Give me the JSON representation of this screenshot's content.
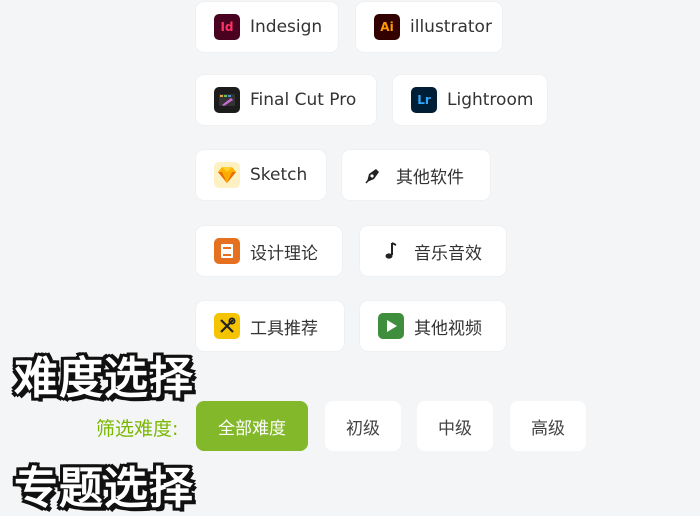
{
  "software": {
    "indesign": {
      "label": "Indesign",
      "icon_text": "Id"
    },
    "illustrator": {
      "label": "illustrator",
      "icon_text": "Ai"
    },
    "finalcut": {
      "label": "Final Cut Pro"
    },
    "lightroom": {
      "label": "Lightroom",
      "icon_text": "Lr"
    },
    "sketch": {
      "label": "Sketch"
    },
    "other_software": {
      "label": "其他软件"
    },
    "design_theory": {
      "label": "设计理论"
    },
    "music_sfx": {
      "label": "音乐音效"
    },
    "tools": {
      "label": "工具推荐"
    },
    "other_video": {
      "label": "其他视频"
    }
  },
  "headers": {
    "difficulty": "难度选择",
    "next": "专题选择"
  },
  "filter": {
    "label": "筛选难度:",
    "options": [
      {
        "label": "全部难度",
        "active": true
      },
      {
        "label": "初级",
        "active": false
      },
      {
        "label": "中级",
        "active": false
      },
      {
        "label": "高级",
        "active": false
      }
    ]
  }
}
